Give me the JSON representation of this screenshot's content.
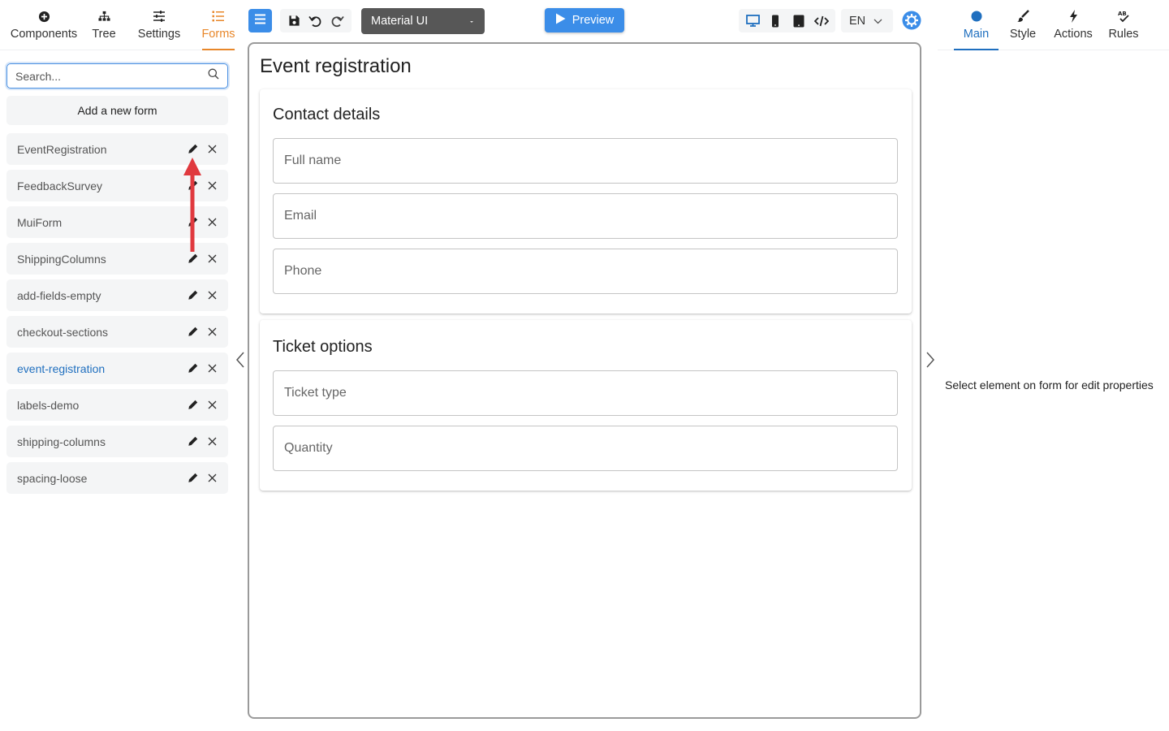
{
  "left_tabs": {
    "components": "Components",
    "tree": "Tree",
    "settings": "Settings",
    "forms": "Forms"
  },
  "search": {
    "placeholder": "Search...",
    "value": ""
  },
  "add_form_label": "Add a new form",
  "forms": [
    {
      "name": "EventRegistration",
      "active": false
    },
    {
      "name": "FeedbackSurvey",
      "active": false
    },
    {
      "name": "MuiForm",
      "active": false
    },
    {
      "name": "ShippingColumns",
      "active": false
    },
    {
      "name": "add-fields-empty",
      "active": false
    },
    {
      "name": "checkout-sections",
      "active": false
    },
    {
      "name": "event-registration",
      "active": true
    },
    {
      "name": "labels-demo",
      "active": false
    },
    {
      "name": "shipping-columns",
      "active": false
    },
    {
      "name": "spacing-loose",
      "active": false
    }
  ],
  "toolbar": {
    "theme": "Material UI",
    "preview": "Preview",
    "language": "EN"
  },
  "form": {
    "title": "Event registration",
    "sections": [
      {
        "title": "Contact details",
        "fields": [
          "Full name",
          "Email",
          "Phone"
        ]
      },
      {
        "title": "Ticket options",
        "fields": [
          "Ticket type",
          "Quantity"
        ]
      }
    ]
  },
  "right_tabs": {
    "main": "Main",
    "style": "Style",
    "actions": "Actions",
    "rules": "Rules"
  },
  "properties_hint": "Select element on form for edit properties",
  "colors": {
    "accent_orange": "#e8872a",
    "accent_blue": "#3b8de8",
    "active_link": "#1f6fbf",
    "annotation_arrow": "#e0393e"
  }
}
